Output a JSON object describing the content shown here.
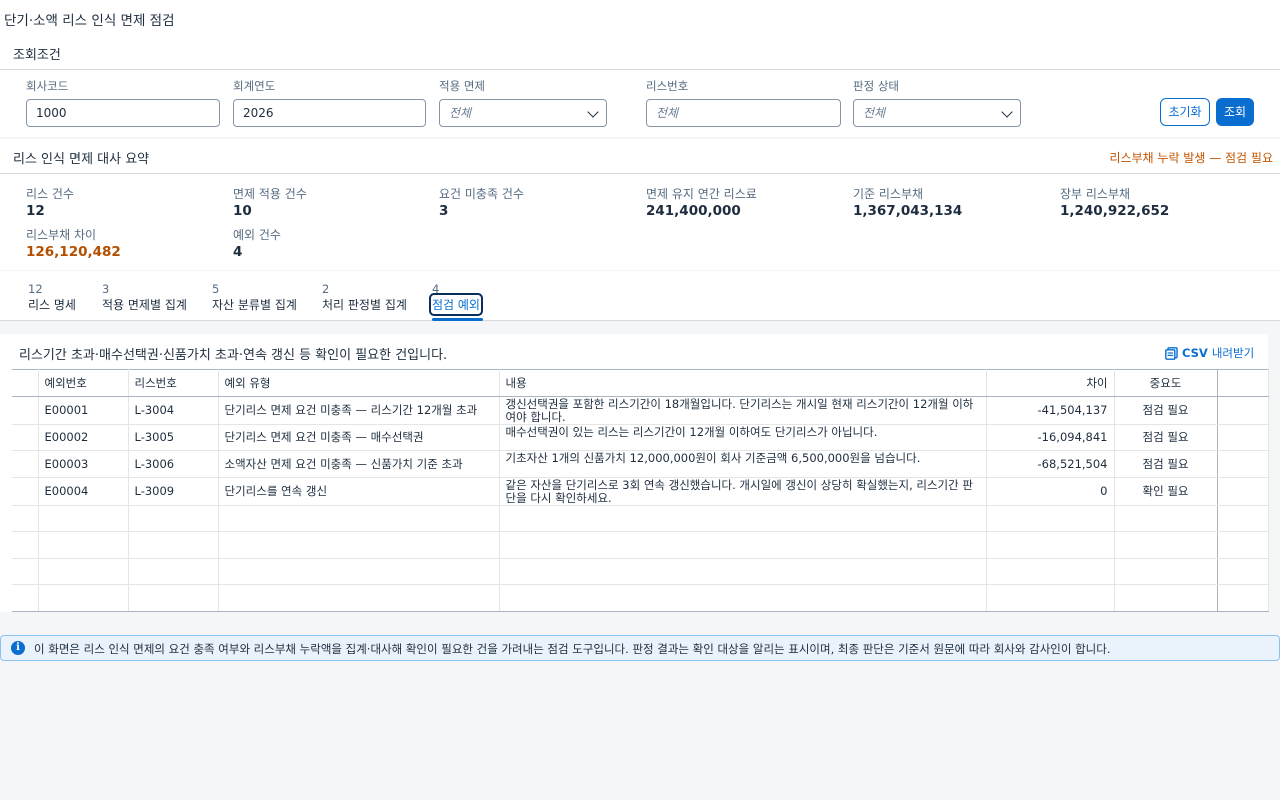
{
  "app": {
    "title": "단기·소액 리스 인식 면제 점검"
  },
  "filters": {
    "section_title": "조회조건",
    "company_code": {
      "label": "회사코드",
      "value": "1000"
    },
    "fiscal_year": {
      "label": "회계연도",
      "value": "2026"
    },
    "exemption": {
      "label": "적용 면제",
      "value": "전체"
    },
    "lease_no": {
      "label": "리스번호",
      "placeholder": "전체"
    },
    "status": {
      "label": "판정 상태",
      "value": "전체"
    },
    "reset_label": "초기화",
    "search_label": "조회"
  },
  "summary": {
    "section_title": "리스 인식 면제 대사 요약",
    "warning": "리스부채 누락 발생 — 점검 필요",
    "kpis": [
      {
        "label": "리스 건수",
        "value": "12"
      },
      {
        "label": "면제 적용 건수",
        "value": "10"
      },
      {
        "label": "요건 미충족 건수",
        "value": "3"
      },
      {
        "label": "면제 유지 연간 리스료",
        "value": "241,400,000"
      },
      {
        "label": "기준 리스부채",
        "value": "1,367,043,134"
      },
      {
        "label": "장부 리스부채",
        "value": "1,240,922,652"
      },
      {
        "label": "리스부채 차이",
        "value": "126,120,482"
      },
      {
        "label": "예외 건수",
        "value": "4"
      }
    ]
  },
  "tabs": [
    {
      "count": "12",
      "label": "리스 명세"
    },
    {
      "count": "3",
      "label": "적용 면제별 집계"
    },
    {
      "count": "5",
      "label": "자산 분류별 집계"
    },
    {
      "count": "2",
      "label": "처리 판정별 집계"
    },
    {
      "count": "4",
      "label": "점검 예외"
    }
  ],
  "exceptions": {
    "description": "리스기간 초과·매수선택권·신품가치 초과·연속 갱신 등 확인이 필요한 건입니다.",
    "csv_label": "CSV",
    "csv_suffix": "내려받기",
    "columns": [
      "예외번호",
      "리스번호",
      "예외 유형",
      "내용",
      "차이",
      "중요도"
    ],
    "rows": [
      {
        "id": "E00001",
        "lease": "L-3004",
        "type": "단기리스 면제 요건 미충족 — 리스기간 12개월 초과",
        "content": "갱신선택권을 포함한 리스기간이 18개월입니다. 단기리스는 개시일 현재 리스기간이 12개월 이하여야 합니다.",
        "diff": "-41,504,137",
        "importance": "점검 필요",
        "level": "warn"
      },
      {
        "id": "E00002",
        "lease": "L-3005",
        "type": "단기리스 면제 요건 미충족 — 매수선택권",
        "content": "매수선택권이 있는 리스는 리스기간이 12개월 이하여도 단기리스가 아닙니다.",
        "diff": "-16,094,841",
        "importance": "점검 필요",
        "level": "warn"
      },
      {
        "id": "E00003",
        "lease": "L-3006",
        "type": "소액자산 면제 요건 미충족 — 신품가치 기준 초과",
        "content": "기초자산 1개의 신품가치 12,000,000원이 회사 기준금액 6,500,000원을 넘습니다.",
        "diff": "-68,521,504",
        "importance": "점검 필요",
        "level": "warn"
      },
      {
        "id": "E00004",
        "lease": "L-3009",
        "type": "단기리스를 연속 갱신",
        "content": "같은 자산을 단기리스로 3회 연속 갱신했습니다. 개시일에 갱신이 상당히 확실했는지, 리스기간 판단을 다시 확인하세요.",
        "diff": "0",
        "importance": "확인 필요",
        "level": "info"
      }
    ],
    "empty_rows": 4
  },
  "notice": {
    "text": "이 화면은 리스 인식 면제의 요건 충족 여부와 리스부채 누락액을 집계·대사해 확인이 필요한 건을 가려내는 점검 도구입니다. 판정 결과는 확인 대상을 알리는 표시이며, 최종 판단은 기준서 원문에 따라 회사와 감사인이 합니다."
  },
  "colors": {
    "accent": "#0a6ed1",
    "warning": "#b44f00",
    "info_bg": "#eaf3fc"
  },
  "icons": {
    "csv": "spreadsheet-icon",
    "notice": "info-icon"
  }
}
